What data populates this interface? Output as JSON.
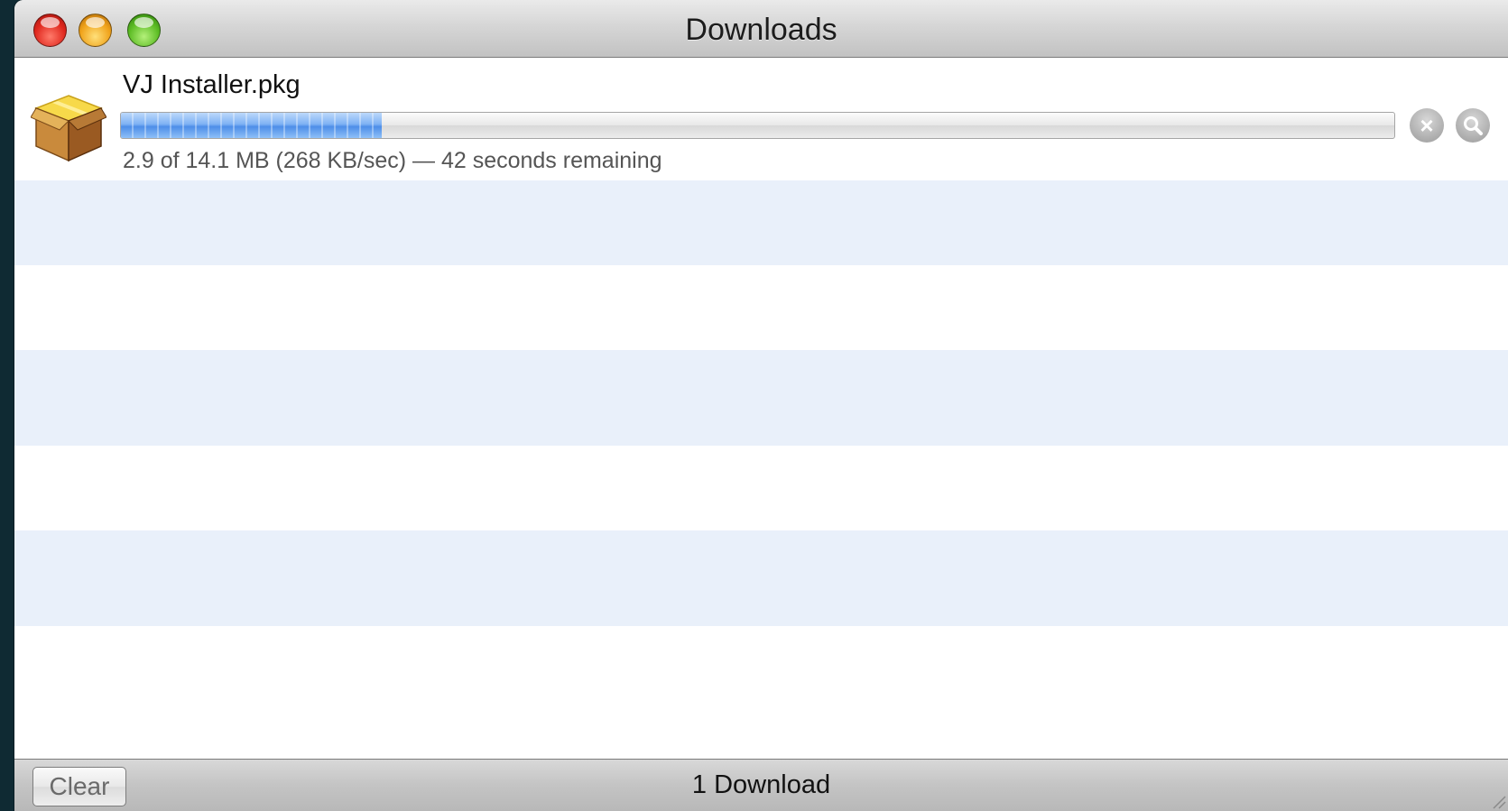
{
  "window": {
    "title": "Downloads"
  },
  "download": {
    "filename": "VJ Installer.pkg",
    "progress_fraction": 0.205,
    "status": "2.9 of 14.1 MB (268 KB/sec) — 42 seconds remaining",
    "stop_icon": "stop-icon",
    "reveal_icon": "magnifier-icon",
    "file_icon": "package-icon"
  },
  "footer": {
    "clear_label": "Clear",
    "count_label": "1 Download"
  },
  "colors": {
    "stripe": "#e9f0fa",
    "progress_blue": "#4d8ee8"
  }
}
